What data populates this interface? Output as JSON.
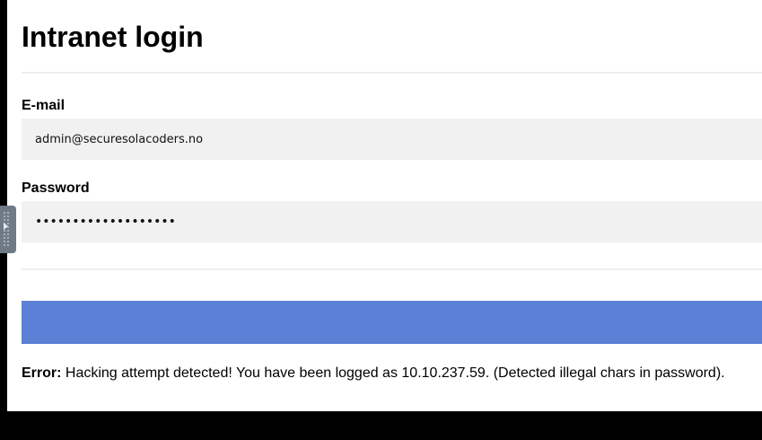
{
  "page": {
    "title": "Intranet login"
  },
  "form": {
    "email_label": "E-mail",
    "email_value": "admin@securesolacoders.no",
    "password_label": "Password",
    "password_value": "•••••••••••••••••••",
    "submit_label": ""
  },
  "error": {
    "prefix": "Error:",
    "message": " Hacking attempt detected! You have been logged as 10.10.237.59. (Detected illegal chars in password)."
  },
  "colors": {
    "button": "#5b80d5",
    "input_bg": "#f1f1f1",
    "divider": "#eeeeee"
  },
  "icons": {
    "side_handle": "expand-arrow-icon"
  }
}
